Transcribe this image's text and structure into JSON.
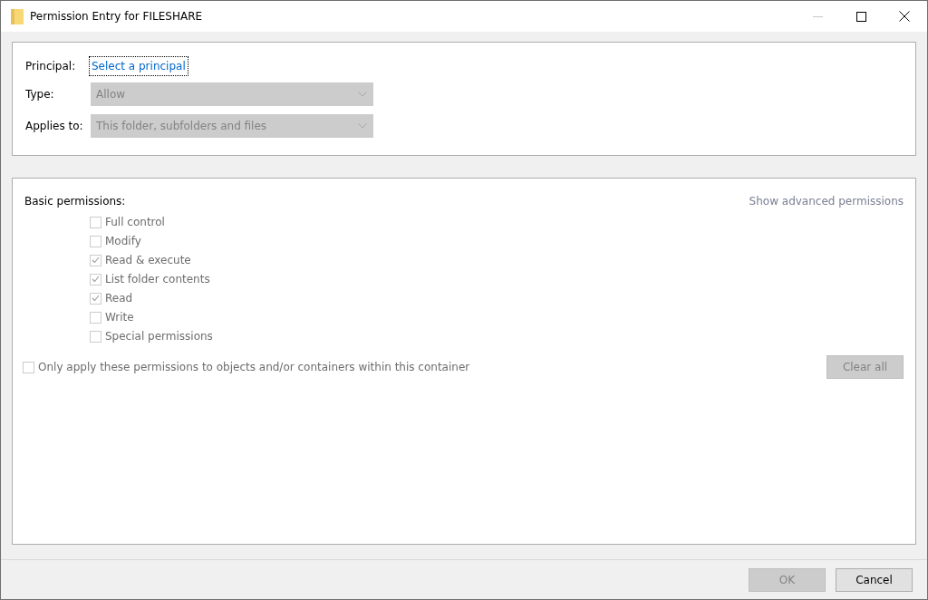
{
  "window": {
    "title": "Permission Entry for FILESHARE",
    "minimize_disabled": true
  },
  "principal": {
    "label": "Principal:",
    "link": "Select a principal"
  },
  "fields": [
    {
      "label": "Type:",
      "value": "Allow",
      "disabled": true
    },
    {
      "label": "Applies to:",
      "value": "This folder, subfolders and files",
      "disabled": true
    }
  ],
  "permissions": {
    "title": "Basic permissions:",
    "advanced_link": "Show advanced permissions",
    "advanced_disabled": true,
    "items": [
      {
        "label": "Full control",
        "checked": false,
        "disabled": true
      },
      {
        "label": "Modify",
        "checked": false,
        "disabled": true
      },
      {
        "label": "Read & execute",
        "checked": true,
        "disabled": true
      },
      {
        "label": "List folder contents",
        "checked": true,
        "disabled": true
      },
      {
        "label": "Read",
        "checked": true,
        "disabled": true
      },
      {
        "label": "Write",
        "checked": false,
        "disabled": true
      },
      {
        "label": "Special permissions",
        "checked": false,
        "disabled": true
      }
    ],
    "only_apply": {
      "label": "Only apply these permissions to objects and/or containers within this container",
      "checked": false,
      "disabled": true
    },
    "clear_all": {
      "label": "Clear all",
      "disabled": true
    }
  },
  "buttons": [
    {
      "label": "OK",
      "disabled": true
    },
    {
      "label": "Cancel",
      "disabled": false
    }
  ]
}
